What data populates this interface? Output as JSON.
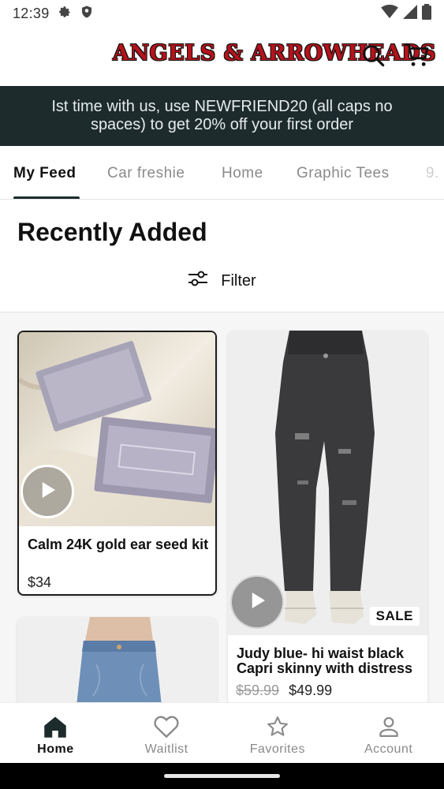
{
  "status_bar": {
    "time": "12:39",
    "left_icons": [
      "gear-icon",
      "shield-icon"
    ],
    "right_icons": [
      "wifi-icon",
      "signal-icon",
      "battery-icon"
    ]
  },
  "header": {
    "logo_text": "ANGELS & ARROWHEADS",
    "icons": [
      "search-icon",
      "cart-icon"
    ]
  },
  "promo": {
    "text": "Ist time with us, use NEWFRIEND20 (all caps no spaces) to get 20% off your first order"
  },
  "tabs": [
    {
      "label": "My Feed",
      "active": true
    },
    {
      "label": "Car freshie",
      "active": false
    },
    {
      "label": "Home",
      "active": false
    },
    {
      "label": "Graphic Tees",
      "active": false
    },
    {
      "label": "9.",
      "active": false
    }
  ],
  "section": {
    "title": "Recently Added",
    "filter_label": "Filter"
  },
  "products": [
    {
      "name": "Calm 24K gold ear seed kit",
      "price": "$34",
      "has_video": true
    },
    {
      "name": "Judy blue- hi waist black Capri skinny with distress",
      "old_price": "$59.99",
      "price": "$49.99",
      "badge": "SALE",
      "has_video": true
    }
  ],
  "bottom_nav": [
    {
      "label": "Home",
      "icon": "home-icon",
      "active": true
    },
    {
      "label": "Waitlist",
      "icon": "heart-icon",
      "active": false
    },
    {
      "label": "Favorites",
      "icon": "star-icon",
      "active": false
    },
    {
      "label": "Account",
      "icon": "account-icon",
      "active": false
    }
  ],
  "colors": {
    "brand_dark": "#1d2b2d",
    "logo_red": "#b5121b",
    "inactive_text": "#8a8a8a"
  }
}
